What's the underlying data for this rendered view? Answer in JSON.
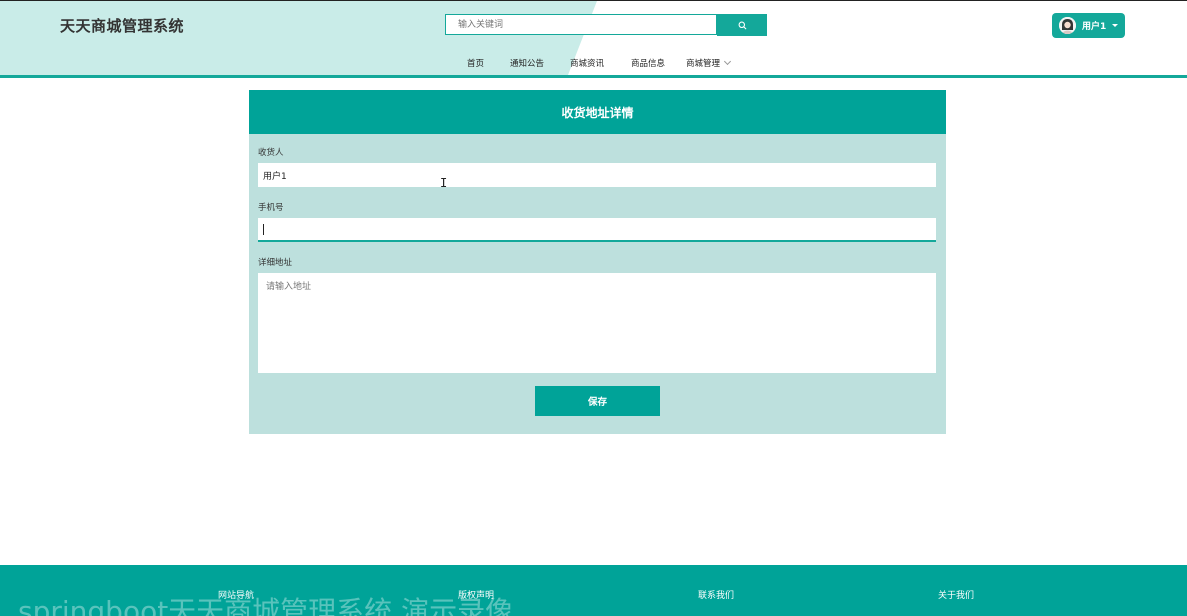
{
  "header": {
    "site_title": "天天商城管理系统",
    "search_placeholder": "输入关键词",
    "user_name": "用户1"
  },
  "nav": {
    "items": [
      "首页",
      "通知公告",
      "商城资讯",
      "商品信息",
      "商城管理"
    ]
  },
  "form": {
    "title": "收货地址详情",
    "receiver_label": "收货人",
    "receiver_value": "用户1",
    "phone_label": "手机号",
    "phone_value": "",
    "address_label": "详细地址",
    "address_placeholder": "请输入地址",
    "save_label": "保存"
  },
  "footer": {
    "links": [
      "网站导航",
      "版权声明",
      "联系我们",
      "关于我们"
    ],
    "watermark": "springboot天天商城管理系统 演示录像"
  },
  "colors": {
    "accent": "#00a398",
    "panel_bg": "#bde0dd",
    "header_tint": "#c9ece8"
  }
}
